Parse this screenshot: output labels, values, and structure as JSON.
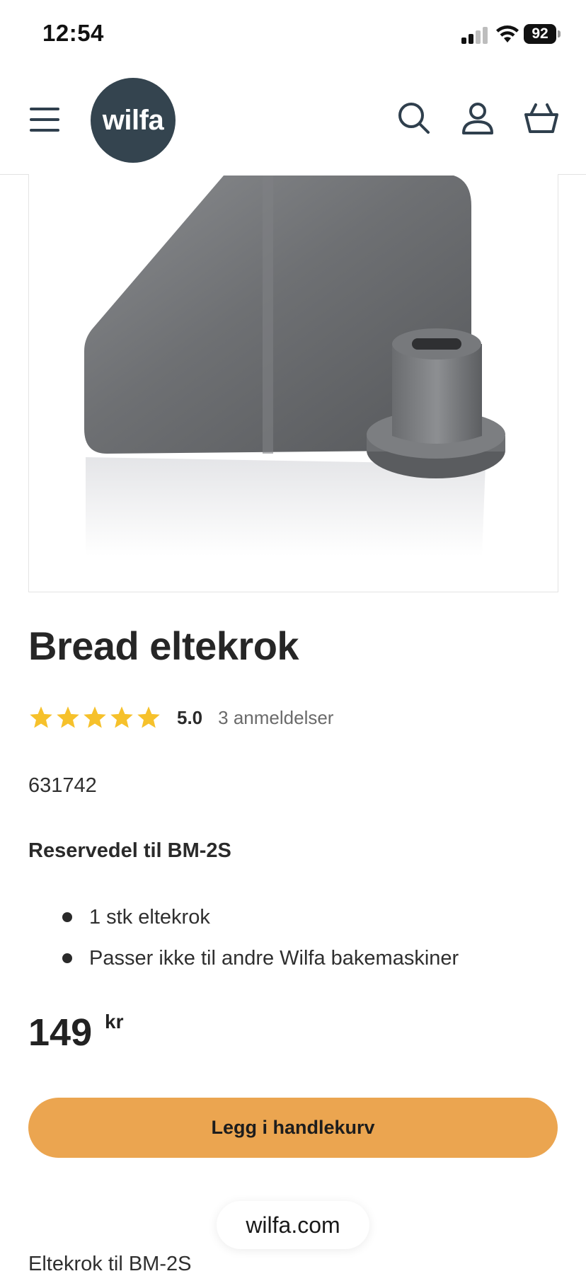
{
  "status_bar": {
    "time": "12:54",
    "battery": "92"
  },
  "header": {
    "logo_text": "wilfa",
    "icons": {
      "menu": "menu-icon",
      "search": "search-icon",
      "account": "account-icon",
      "cart": "basket-icon"
    },
    "brand_color": "#34444f"
  },
  "product": {
    "title": "Bread eltekrok",
    "rating": {
      "stars": 5,
      "score": "5.0",
      "count_text": "3 anmeldelser",
      "star_color": "#f6c12b"
    },
    "sku": "631742",
    "subheading": "Reservedel til BM-2S",
    "features": [
      "1 stk eltekrok",
      "Passer ikke til andre Wilfa bakemaskiner"
    ],
    "price": {
      "amount": "149",
      "currency": "kr"
    },
    "add_to_cart_label": "Legg i handlekurv",
    "add_to_cart_color": "#eba550",
    "description_start": "Eltekrok til BM-2S"
  },
  "browser": {
    "url": "wilfa.com"
  }
}
